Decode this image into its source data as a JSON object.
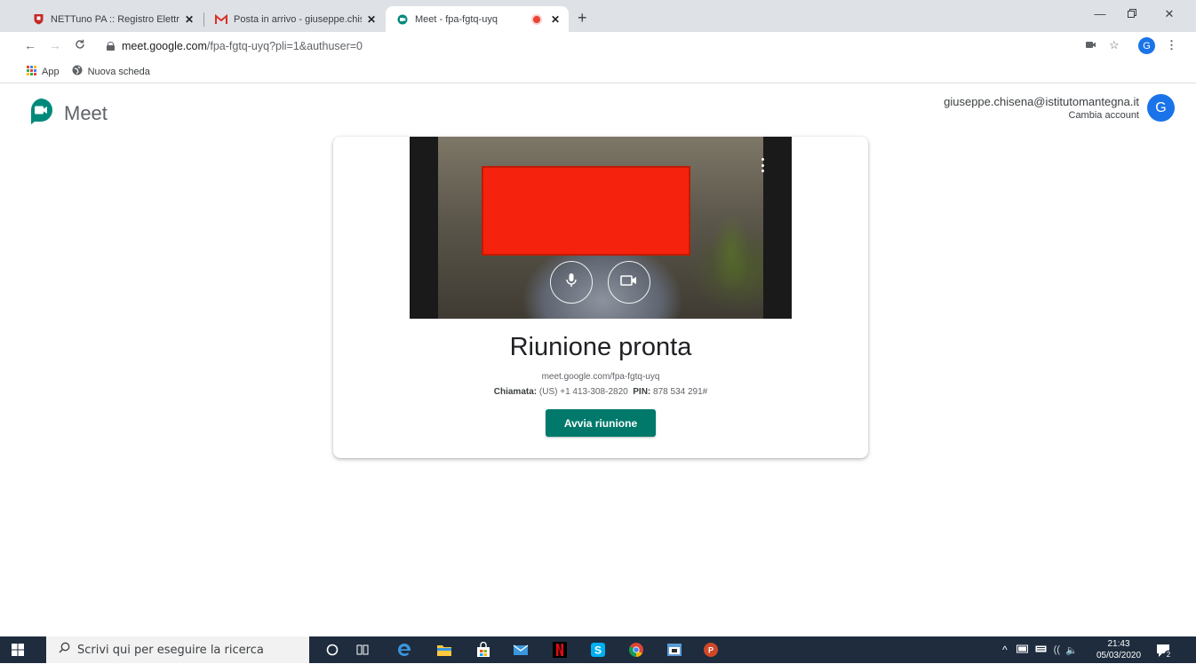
{
  "browser": {
    "tabs": [
      {
        "title": "NETTuno PA :: Registro Elettronic",
        "favicon": "nettuno-shield-icon"
      },
      {
        "title": "Posta in arrivo - giuseppe.chisen",
        "favicon": "gmail-icon"
      },
      {
        "title": "Meet - fpa-fgtq-uyq",
        "favicon": "meet-icon",
        "recording": true,
        "active": true
      }
    ],
    "new_tab": "+",
    "url_host": "meet.google.com",
    "url_path": "/fpa-fgtq-uyq?pli=1&authuser=0",
    "profile_initial": "G",
    "bookmarks": [
      {
        "label": "App",
        "icon": "apps-grid-icon"
      },
      {
        "label": "Nuova scheda",
        "icon": "globe-icon"
      }
    ]
  },
  "meet": {
    "logo_text": "Meet",
    "account_email": "giuseppe.chisena@istitutomantegna.it",
    "switch_account": "Cambia account",
    "avatar_initial": "G",
    "title": "Riunione pronta",
    "meeting_link": "meet.google.com/fpa-fgtq-uyq",
    "dial_label": "Chiamata:",
    "dial_number": "(US) +1 413-308-2820",
    "pin_label": "PIN:",
    "pin_value": "878 534 291#",
    "start_button": "Avvia riunione"
  },
  "taskbar": {
    "search_placeholder": "Scrivi qui per eseguire la ricerca",
    "time": "21:43",
    "date": "05/03/2020",
    "notifications": "2"
  },
  "colors": {
    "accent_green": "#00796b",
    "google_blue": "#1a73e8",
    "taskbar": "#1e2c3e",
    "redaction": "#f5220d"
  }
}
